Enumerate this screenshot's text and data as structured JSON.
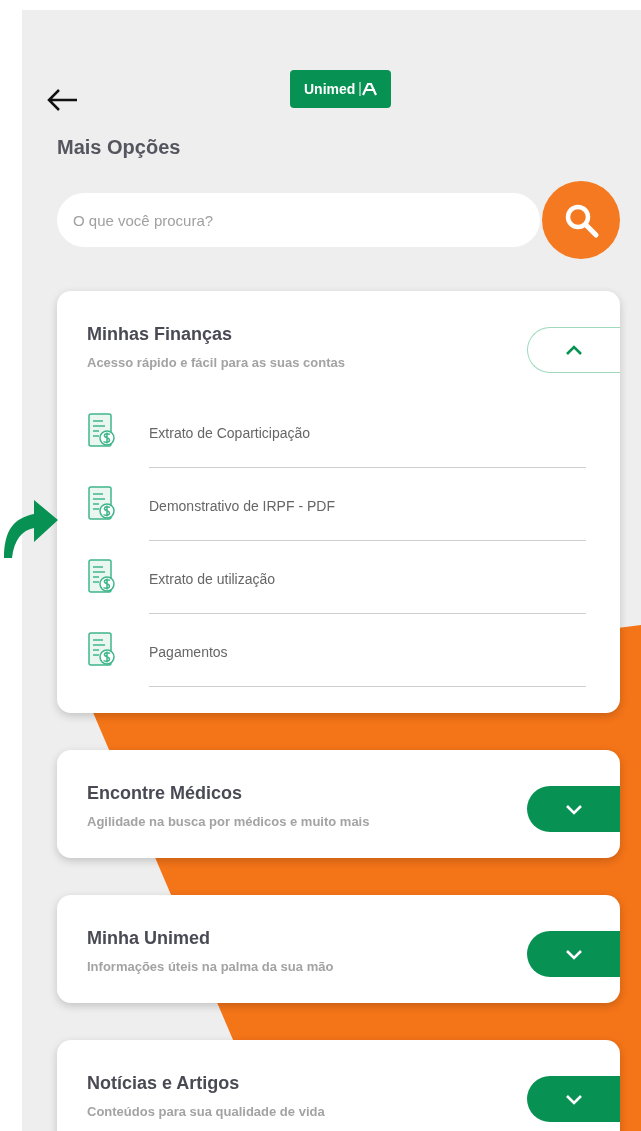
{
  "header": {
    "logo": "Unimed"
  },
  "title": "Mais Opções",
  "search": {
    "placeholder": "O que você procura?"
  },
  "sections": [
    {
      "title": "Minhas Finanças",
      "subtitle": "Acesso rápido e fácil para as suas contas",
      "expanded": true,
      "items": [
        {
          "label": "Extrato de Coparticipação"
        },
        {
          "label": "Demonstrativo de IRPF - PDF"
        },
        {
          "label": "Extrato de utilização"
        },
        {
          "label": "Pagamentos"
        }
      ]
    },
    {
      "title": "Encontre Médicos",
      "subtitle": "Agilidade na busca por médicos e muito mais",
      "expanded": false
    },
    {
      "title": "Minha Unimed",
      "subtitle": "Informações úteis na palma da sua mão",
      "expanded": false
    },
    {
      "title": "Notícias e Artigos",
      "subtitle": "Conteúdos para sua qualidade de vida",
      "expanded": false
    }
  ]
}
